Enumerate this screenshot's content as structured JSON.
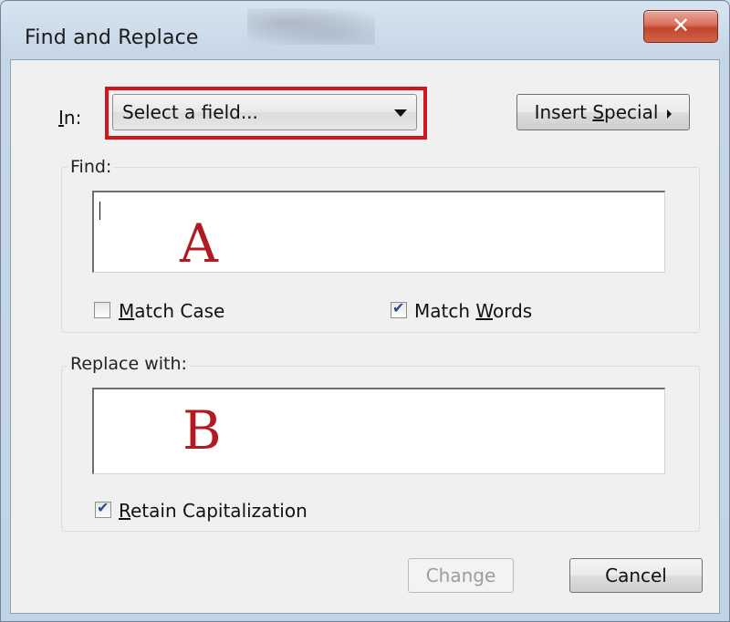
{
  "window": {
    "title": "Find and Replace",
    "close_glyph": "✕"
  },
  "field_selector": {
    "label_u": "I",
    "label_rest": "n:",
    "value": "Select a field..."
  },
  "insert_special": {
    "label_pre": "Insert ",
    "label_u": "S",
    "label_post": "pecial"
  },
  "find": {
    "label": "Find:",
    "annotation": "A",
    "match_case": {
      "checked": false,
      "label_u": "M",
      "label_rest": "atch Case"
    },
    "match_words": {
      "checked": true,
      "label_pre": "Match ",
      "label_u": "W",
      "label_post": "ords"
    }
  },
  "replace": {
    "label": "Replace with:",
    "annotation": "B",
    "retain_caps": {
      "checked": true,
      "label_u": "R",
      "label_rest": "etain Capitalization"
    }
  },
  "buttons": {
    "change": "Change",
    "cancel": "Cancel"
  },
  "colors": {
    "highlight_border": "#d0161c",
    "annotation": "#b01a20",
    "close_button": "#c3452c"
  }
}
